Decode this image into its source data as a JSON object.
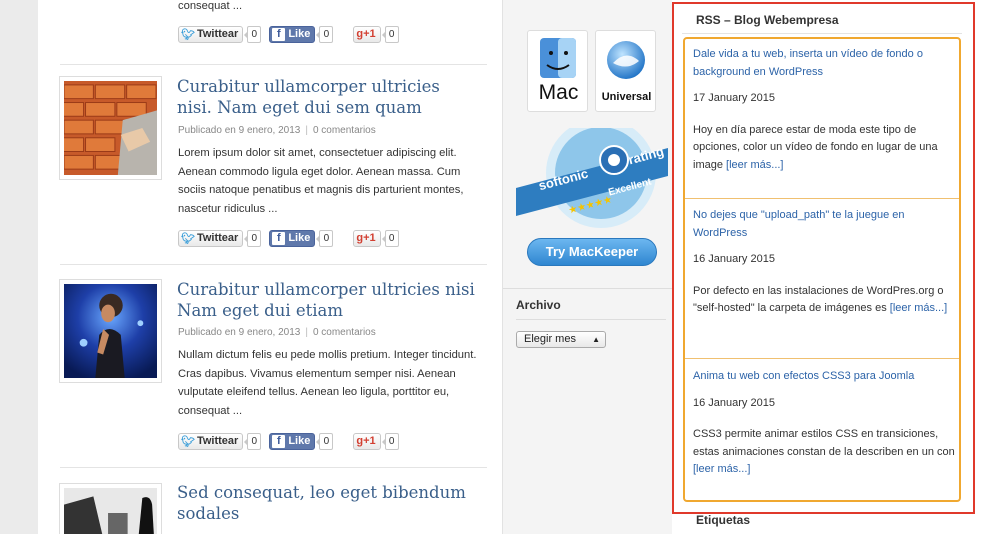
{
  "top_fragment": {
    "text": "consequat ..."
  },
  "social_labels": {
    "twitter": "Twittear",
    "facebook": "Like",
    "gplus": "+1"
  },
  "posts": [
    {
      "counts": {
        "twitter": "0",
        "facebook": "0",
        "gplus": "0"
      }
    },
    {
      "title": "Curabitur ullamcorper ultricies nisi. Nam eget dui sem quam",
      "published": "Publicado en 9 enero, 2013",
      "comments": "0 comentarios",
      "excerpt": "Lorem ipsum dolor sit amet, consectetuer adipiscing elit. Aenean commodo ligula eget dolor. Aenean massa. Cum sociis natoque penatibus et magnis dis parturient montes, nascetur ridiculus ...",
      "counts": {
        "twitter": "0",
        "facebook": "0",
        "gplus": "0"
      }
    },
    {
      "title": "Curabitur ullamcorper ultricies nisi Nam eget dui etiam",
      "published": "Publicado en 9 enero, 2013",
      "comments": "0 comentarios",
      "excerpt": "Nullam dictum felis eu pede mollis pretium. Integer tincidunt. Cras dapibus. Vivamus elementum semper nisi. Aenean vulputate eleifend tellus. Aenean leo ligula, porttitor eu, consequat ...",
      "counts": {
        "twitter": "0",
        "facebook": "0",
        "gplus": "0"
      }
    },
    {
      "title": "Sed consequat, leo eget bibendum sodales"
    }
  ],
  "middle": {
    "badge_mac": "Mac",
    "badge_universal": "Universal",
    "softonic_brand": "softonic",
    "softonic_rating": "rating",
    "softonic_excellent": "Excellent",
    "mackeeper_button": "Try MacKeeper",
    "archive_title": "Archivo",
    "archive_select": "Elegir mes"
  },
  "rss": {
    "title": "RSS – Blog Webempresa",
    "items": [
      {
        "link": "Dale vida a tu web, inserta un vídeo de fondo o background en WordPress",
        "date": "17 January 2015",
        "summary": "Hoy en día parece estar de moda este tipo de opciones, color un vídeo de fondo en lugar de una image",
        "more": "[leer más...]"
      },
      {
        "link": "No dejes que \"upload_path\" te la juegue en WordPress",
        "date": "16 January 2015",
        "summary": "Por defecto en las instalaciones de WordPres.org o \"self-hosted\" la carpeta de imágenes es",
        "more": "[leer más...]"
      },
      {
        "link": "Anima tu web con efectos CSS3 para Joomla",
        "date": "16 January 2015",
        "summary": "CSS3 permite animar estilos CSS en transiciones, estas animaciones constan de la describen en un con",
        "more": "[leer más...]"
      }
    ]
  },
  "etiquetas_title": "Etiquetas",
  "colors": {
    "title_link": "#3a5f8a",
    "rss_link": "#2c63a8",
    "highlight_red": "#e0392b",
    "highlight_orange": "#f0a830"
  }
}
